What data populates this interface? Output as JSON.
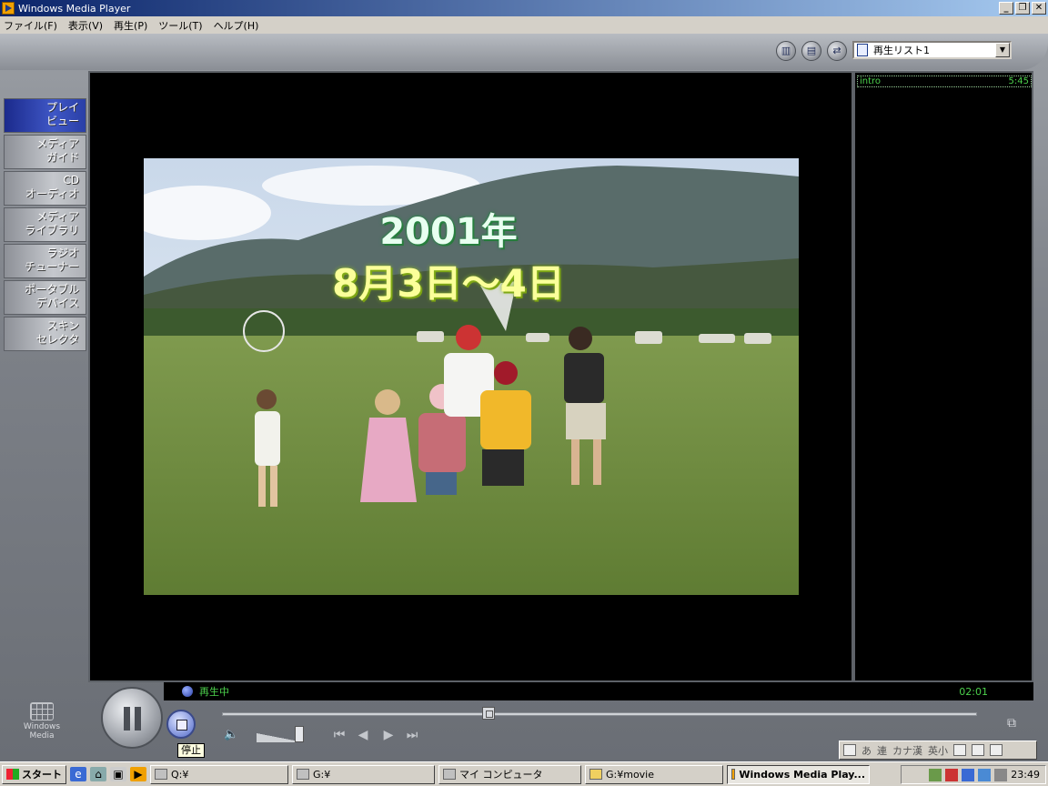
{
  "window": {
    "title": "Windows Media Player"
  },
  "menu": [
    "ファイル(F)",
    "表示(V)",
    "再生(P)",
    "ツール(T)",
    "ヘルプ(H)"
  ],
  "toolbar": {
    "playlist_selected": "再生リスト1"
  },
  "sidenav": [
    {
      "label": "プレイ\nビュー",
      "active": true
    },
    {
      "label": "メディア\nガイド",
      "active": false
    },
    {
      "label": "CD\nオーディオ",
      "active": false
    },
    {
      "label": "メディア\nライブラリ",
      "active": false
    },
    {
      "label": "ラジオ\nチューナー",
      "active": false
    },
    {
      "label": "ポータブル\nデバイス",
      "active": false
    },
    {
      "label": "スキン\nセレクタ",
      "active": false
    }
  ],
  "video": {
    "overlay_year": "2001年",
    "overlay_date": "8月3日～4日"
  },
  "playlist": {
    "items": [
      {
        "title": "intro",
        "duration": "5:45"
      }
    ]
  },
  "status": {
    "text": "再生中",
    "elapsed": "02:01"
  },
  "transport": {
    "stop_tooltip": "停止",
    "logo_text": "Windows Media",
    "seek_fraction": 0.35,
    "volume_fraction": 0.85
  },
  "ime": {
    "items": [
      "あ",
      "連",
      "カナ漢",
      "英小"
    ]
  },
  "taskbar": {
    "start_label": "スタート",
    "tasks": [
      {
        "label": "Q:¥",
        "active": false
      },
      {
        "label": "G:¥",
        "active": false
      },
      {
        "label": "マイ コンピュータ",
        "active": false
      },
      {
        "label": "G:¥movie",
        "active": false
      },
      {
        "label": "Windows Media Play...",
        "active": true
      }
    ],
    "clock": "23:49"
  },
  "colors": {
    "accent": "#2a3fa6",
    "status_green": "#4cd04c",
    "title_gradient_start": "#0a246a"
  }
}
